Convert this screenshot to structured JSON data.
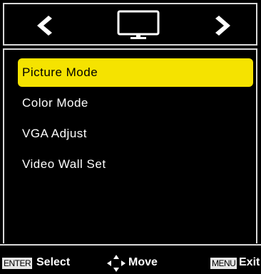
{
  "header": {
    "prev_icon": "chevron-left-icon",
    "category_icon": "monitor-icon",
    "next_icon": "chevron-right-icon"
  },
  "menu": {
    "items": [
      {
        "label": "Picture Mode",
        "selected": true
      },
      {
        "label": "Color Mode",
        "selected": false
      },
      {
        "label": "VGA Adjust",
        "selected": false
      },
      {
        "label": "Video Wall Set",
        "selected": false
      }
    ]
  },
  "footer": {
    "enter_key": "ENTER",
    "select_label": "Select",
    "move_icon": "four-way-arrow-icon",
    "move_label": "Move",
    "menu_key": "MENU",
    "exit_label": "Exit"
  },
  "colors": {
    "background": "#000000",
    "highlight": "#f5e300",
    "border": "#d9d9d9",
    "text": "#ffffff"
  }
}
